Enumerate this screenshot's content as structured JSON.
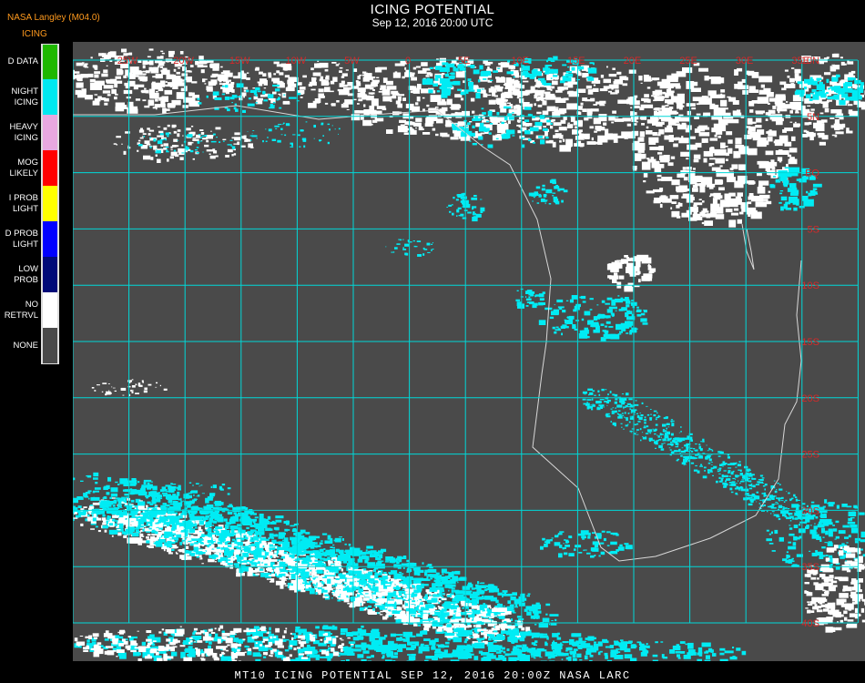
{
  "header": {
    "credit": "NASA Langley (M04.0)",
    "product": "ICING",
    "title": "ICING POTENTIAL",
    "subtitle": "Sep 12, 2016 20:00 UTC"
  },
  "legend": [
    {
      "label": "D DATA",
      "color": "#1fb800"
    },
    {
      "label": "NIGHT\nICING",
      "color": "#00e8f0"
    },
    {
      "label": "HEAVY\nICING",
      "color": "#e8a8e0"
    },
    {
      "label": "MOG\nLIKELY",
      "color": "#ff0000"
    },
    {
      "label": "I PROB\nLIGHT",
      "color": "#ffff00"
    },
    {
      "label": "D PROB\nLIGHT",
      "color": "#0000ff"
    },
    {
      "label": "LOW\nPROB",
      "color": "#000a78"
    },
    {
      "label": "NO\nRETRVL",
      "color": "#ffffff"
    },
    {
      "label": "NONE",
      "color": "#4a4a4a"
    }
  ],
  "map": {
    "background": "#4a4a4a",
    "grid_color": "#00d8d8",
    "cloud_color": "#ffffff",
    "icing_color": "#00ecf4",
    "coast_color": "#d8d8d8",
    "label_color": "#d42a2a",
    "lon_labels": [
      "25W",
      "20W",
      "15W",
      "10W",
      "5W",
      "0",
      "5E",
      "10E",
      "15E",
      "20E",
      "25E",
      "30E",
      "35E"
    ],
    "lat_labels": [
      "10N",
      "5N",
      "EQ",
      "5S",
      "10S",
      "15S",
      "20S",
      "25S",
      "30S",
      "35S",
      "40S"
    ]
  },
  "footer": {
    "caption": "MT10  ICING POTENTIAL   SEP 12, 2016 20:00Z   NASA LARC"
  }
}
